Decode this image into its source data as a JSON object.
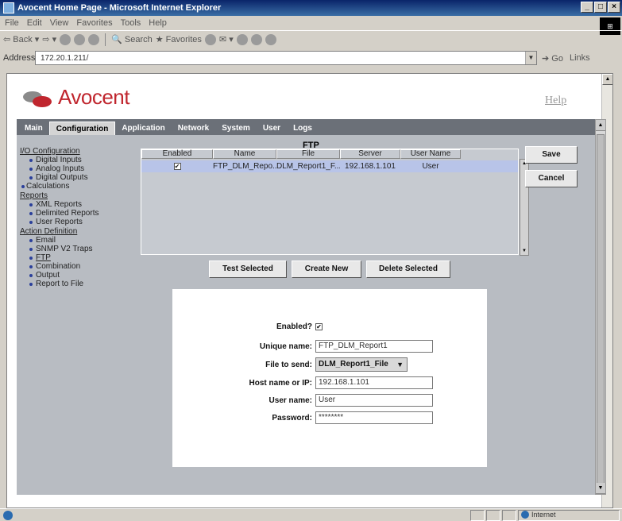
{
  "window": {
    "title": "Avocent Home Page - Microsoft Internet Explorer",
    "controls": [
      "_",
      "□",
      "×"
    ]
  },
  "menubar": [
    "File",
    "Edit",
    "View",
    "Favorites",
    "Tools",
    "Help"
  ],
  "toolbar": {
    "back": "Back",
    "search": "Search",
    "favorites": "Favorites"
  },
  "address": {
    "label": "Address",
    "value": "172.20.1.211/",
    "go": "Go",
    "links": "Links"
  },
  "page": {
    "brand": "Avocent",
    "help": "Help",
    "tabs": [
      {
        "label": "Main",
        "active": false
      },
      {
        "label": "Configuration",
        "active": true
      },
      {
        "label": "Application",
        "active": false
      },
      {
        "label": "Network",
        "active": false
      },
      {
        "label": "System",
        "active": false
      },
      {
        "label": "User",
        "active": false
      },
      {
        "label": "Logs",
        "active": false
      }
    ],
    "sidebar": {
      "io_config": "I/O Configuration",
      "digital_inputs": "Digital Inputs",
      "analog_inputs": "Analog Inputs",
      "digital_outputs": "Digital Outputs",
      "calculations": "Calculations",
      "reports": "Reports",
      "xml_reports": "XML Reports",
      "delimited_reports": "Delimited Reports",
      "user_reports": "User Reports",
      "action_definition": "Action Definition",
      "email": "Email",
      "snmp": "SNMP V2 Traps",
      "ftp": "FTP",
      "combination": "Combination",
      "output": "Output",
      "report_to_file": "Report to File"
    },
    "ftp_table": {
      "title": "FTP",
      "headers": [
        "Enabled",
        "Name",
        "File",
        "Server",
        "User Name"
      ],
      "rows": [
        {
          "enabled": "✔",
          "name": "FTP_DLM_Repo...",
          "file": "DLM_Report1_F...",
          "server": "192.168.1.101",
          "user": "User"
        }
      ]
    },
    "buttons": {
      "save": "Save",
      "cancel": "Cancel",
      "test_selected": "Test Selected",
      "create_new": "Create New",
      "delete_selected": "Delete Selected"
    },
    "form": {
      "enabled_label": "Enabled?",
      "enabled_value": "✔",
      "unique_name_label": "Unique name:",
      "unique_name_value": "FTP_DLM_Report1",
      "file_label": "File to send:",
      "file_value": "DLM_Report1_File",
      "host_label": "Host name or IP:",
      "host_value": "192.168.1.101",
      "user_label": "User name:",
      "user_value": "User",
      "password_label": "Password:",
      "password_value": "********"
    }
  },
  "status": {
    "zone": "Internet"
  },
  "colors": {
    "brand_red": "#c0262e",
    "panel_gray": "#b8bcc2",
    "selected_row": "#b8c4e8",
    "tab_bar": "#6b7078"
  }
}
